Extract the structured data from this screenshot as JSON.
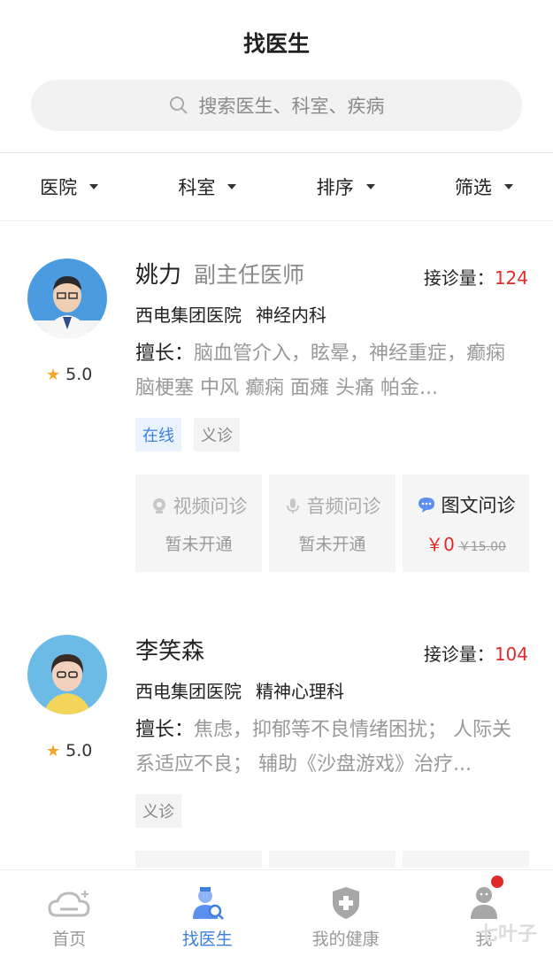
{
  "header": {
    "title": "找医生"
  },
  "search": {
    "placeholder": "搜索医生、科室、疾病"
  },
  "filters": [
    {
      "label": "医院"
    },
    {
      "label": "科室"
    },
    {
      "label": "排序"
    },
    {
      "label": "筛选"
    }
  ],
  "doctors": [
    {
      "name": "姚力",
      "rank": "副主任医师",
      "visits_label": "接诊量：",
      "visits": "124",
      "hospital": "西电集团医院",
      "department": "神经内科",
      "rating": "5.0",
      "specialty_label": "擅长：",
      "specialty": "脑血管介入，眩晕，神经重症，癫痫 脑梗塞 中风 癫痫 面瘫 头痛 帕金...",
      "tags": [
        "在线",
        "义诊"
      ],
      "services": [
        {
          "title": "视频问诊",
          "status": "暂未开通",
          "icon": "video-icon"
        },
        {
          "title": "音频问诊",
          "status": "暂未开通",
          "icon": "microphone-icon"
        },
        {
          "title": "图文问诊",
          "price": "￥0",
          "original_price": "￥15.00",
          "icon": "chat-bubble-icon"
        }
      ]
    },
    {
      "name": "李笑森",
      "visits_label": "接诊量：",
      "visits": "104",
      "hospital": "西电集团医院",
      "department": "精神心理科",
      "rating": "5.0",
      "specialty_label": "擅长：",
      "specialty": "焦虑，抑郁等不良情绪困扰； 人际关系适应不良； 辅助《沙盘游戏》治疗...",
      "tags": [
        "义诊"
      ]
    }
  ],
  "tabbar": [
    {
      "label": "首页",
      "icon": "home-cloud-icon"
    },
    {
      "label": "找医生",
      "icon": "find-doctor-icon"
    },
    {
      "label": "我的健康",
      "icon": "health-shield-icon"
    },
    {
      "label": "我",
      "icon": "user-icon"
    }
  ],
  "watermark": "七叶子",
  "colors": {
    "accent": "#3c7fe0",
    "price": "#e02b2b",
    "star": "#f5a623"
  }
}
